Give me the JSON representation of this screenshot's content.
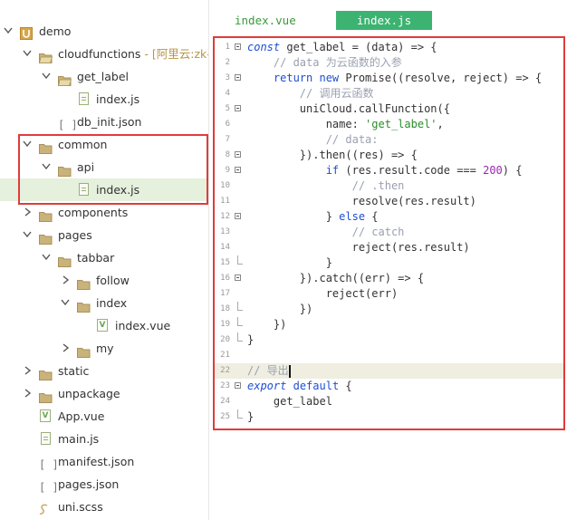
{
  "tree": [
    {
      "label": "demo",
      "indent": 0,
      "chevron": "down",
      "icon": "project",
      "type": "project"
    },
    {
      "label": "cloudfunctions",
      "extra": " - [阿里云:zk-d",
      "indent": 1,
      "chevron": "down",
      "icon": "folder-open"
    },
    {
      "label": "get_label",
      "indent": 2,
      "chevron": "down",
      "icon": "folder-open"
    },
    {
      "label": "index.js",
      "indent": 3,
      "chevron": "none",
      "icon": "file"
    },
    {
      "label": "db_init.json",
      "indent": 2,
      "chevron": "none",
      "icon": "json"
    },
    {
      "label": "common",
      "indent": 1,
      "chevron": "down",
      "icon": "folder"
    },
    {
      "label": "api",
      "indent": 2,
      "chevron": "down",
      "icon": "folder"
    },
    {
      "label": "index.js",
      "indent": 3,
      "chevron": "none",
      "icon": "file",
      "selected": true
    },
    {
      "label": "components",
      "indent": 1,
      "chevron": "right",
      "icon": "folder"
    },
    {
      "label": "pages",
      "indent": 1,
      "chevron": "down",
      "icon": "folder"
    },
    {
      "label": "tabbar",
      "indent": 2,
      "chevron": "down",
      "icon": "folder"
    },
    {
      "label": "follow",
      "indent": 3,
      "chevron": "right",
      "icon": "folder"
    },
    {
      "label": "index",
      "indent": 3,
      "chevron": "down",
      "icon": "folder"
    },
    {
      "label": "index.vue",
      "indent": 4,
      "chevron": "none",
      "icon": "vue"
    },
    {
      "label": "my",
      "indent": 3,
      "chevron": "right",
      "icon": "folder"
    },
    {
      "label": "static",
      "indent": 1,
      "chevron": "right",
      "icon": "folder"
    },
    {
      "label": "unpackage",
      "indent": 1,
      "chevron": "right",
      "icon": "folder"
    },
    {
      "label": "App.vue",
      "indent": 1,
      "chevron": "none",
      "icon": "vue"
    },
    {
      "label": "main.js",
      "indent": 1,
      "chevron": "none",
      "icon": "file"
    },
    {
      "label": "manifest.json",
      "indent": 1,
      "chevron": "none",
      "icon": "json"
    },
    {
      "label": "pages.json",
      "indent": 1,
      "chevron": "none",
      "icon": "json"
    },
    {
      "label": "uni.scss",
      "indent": 1,
      "chevron": "none",
      "icon": "scss"
    }
  ],
  "tabs": {
    "inactive": "index.vue",
    "active": "index.js"
  },
  "code_lines": [
    {
      "n": "1",
      "fold": "open",
      "segs": [
        [
          "kw",
          "const"
        ],
        [
          "tx",
          " get_label = (data) => {"
        ]
      ]
    },
    {
      "n": "2",
      "segs": [
        [
          "tx",
          "    "
        ],
        [
          "cm",
          "// data 为云函数的入参"
        ]
      ]
    },
    {
      "n": "3",
      "fold": "open",
      "segs": [
        [
          "tx",
          "    "
        ],
        [
          "kw2",
          "return new"
        ],
        [
          "tx",
          " Promise((resolve, reject) => {"
        ]
      ]
    },
    {
      "n": "4",
      "segs": [
        [
          "tx",
          "        "
        ],
        [
          "cm",
          "// 调用云函数"
        ]
      ]
    },
    {
      "n": "5",
      "fold": "open",
      "segs": [
        [
          "tx",
          "        uniCloud.callFunction({"
        ]
      ]
    },
    {
      "n": "6",
      "segs": [
        [
          "tx",
          "            name: "
        ],
        [
          "str",
          "'get_label'"
        ],
        [
          "tx",
          ","
        ]
      ]
    },
    {
      "n": "7",
      "segs": [
        [
          "tx",
          "            "
        ],
        [
          "cm",
          "// data:"
        ]
      ]
    },
    {
      "n": "8",
      "fold": "open",
      "segs": [
        [
          "tx",
          "        }).then((res) => {"
        ]
      ]
    },
    {
      "n": "9",
      "fold": "open",
      "segs": [
        [
          "tx",
          "            "
        ],
        [
          "kw2",
          "if"
        ],
        [
          "tx",
          " (res.result.code === "
        ],
        [
          "num",
          "200"
        ],
        [
          "tx",
          ") {"
        ]
      ]
    },
    {
      "n": "10",
      "segs": [
        [
          "tx",
          "                "
        ],
        [
          "cm",
          "// .then"
        ]
      ]
    },
    {
      "n": "11",
      "segs": [
        [
          "tx",
          "                resolve(res.result)"
        ]
      ]
    },
    {
      "n": "12",
      "fold": "open",
      "segs": [
        [
          "tx",
          "            } "
        ],
        [
          "kw2",
          "else"
        ],
        [
          "tx",
          " {"
        ]
      ]
    },
    {
      "n": "13",
      "segs": [
        [
          "tx",
          "                "
        ],
        [
          "cm",
          "// catch"
        ]
      ]
    },
    {
      "n": "14",
      "segs": [
        [
          "tx",
          "                reject(res.result)"
        ]
      ]
    },
    {
      "n": "15",
      "fold": "end",
      "segs": [
        [
          "tx",
          "            }"
        ]
      ]
    },
    {
      "n": "16",
      "fold": "open",
      "segs": [
        [
          "tx",
          "        }).catch((err) => {"
        ]
      ]
    },
    {
      "n": "17",
      "segs": [
        [
          "tx",
          "            reject(err)"
        ]
      ]
    },
    {
      "n": "18",
      "fold": "end",
      "segs": [
        [
          "tx",
          "        })"
        ]
      ]
    },
    {
      "n": "19",
      "fold": "end",
      "segs": [
        [
          "tx",
          "    })"
        ]
      ]
    },
    {
      "n": "20",
      "fold": "end",
      "segs": [
        [
          "tx",
          "}"
        ]
      ]
    },
    {
      "n": "21",
      "segs": []
    },
    {
      "n": "22",
      "active": true,
      "cursor": true,
      "segs": [
        [
          "cm",
          "// 导出"
        ]
      ]
    },
    {
      "n": "23",
      "fold": "open",
      "segs": [
        [
          "kw",
          "export"
        ],
        [
          "tx",
          " "
        ],
        [
          "kw2",
          "default"
        ],
        [
          "tx",
          " {"
        ]
      ]
    },
    {
      "n": "24",
      "segs": [
        [
          "tx",
          "    get_label"
        ]
      ]
    },
    {
      "n": "25",
      "fold": "end",
      "segs": [
        [
          "tx",
          "}"
        ]
      ]
    }
  ],
  "colors": {
    "highlight_box": "#e03b3b",
    "selected_row": "#e5f0dd",
    "active_tab": "#3cb371"
  }
}
